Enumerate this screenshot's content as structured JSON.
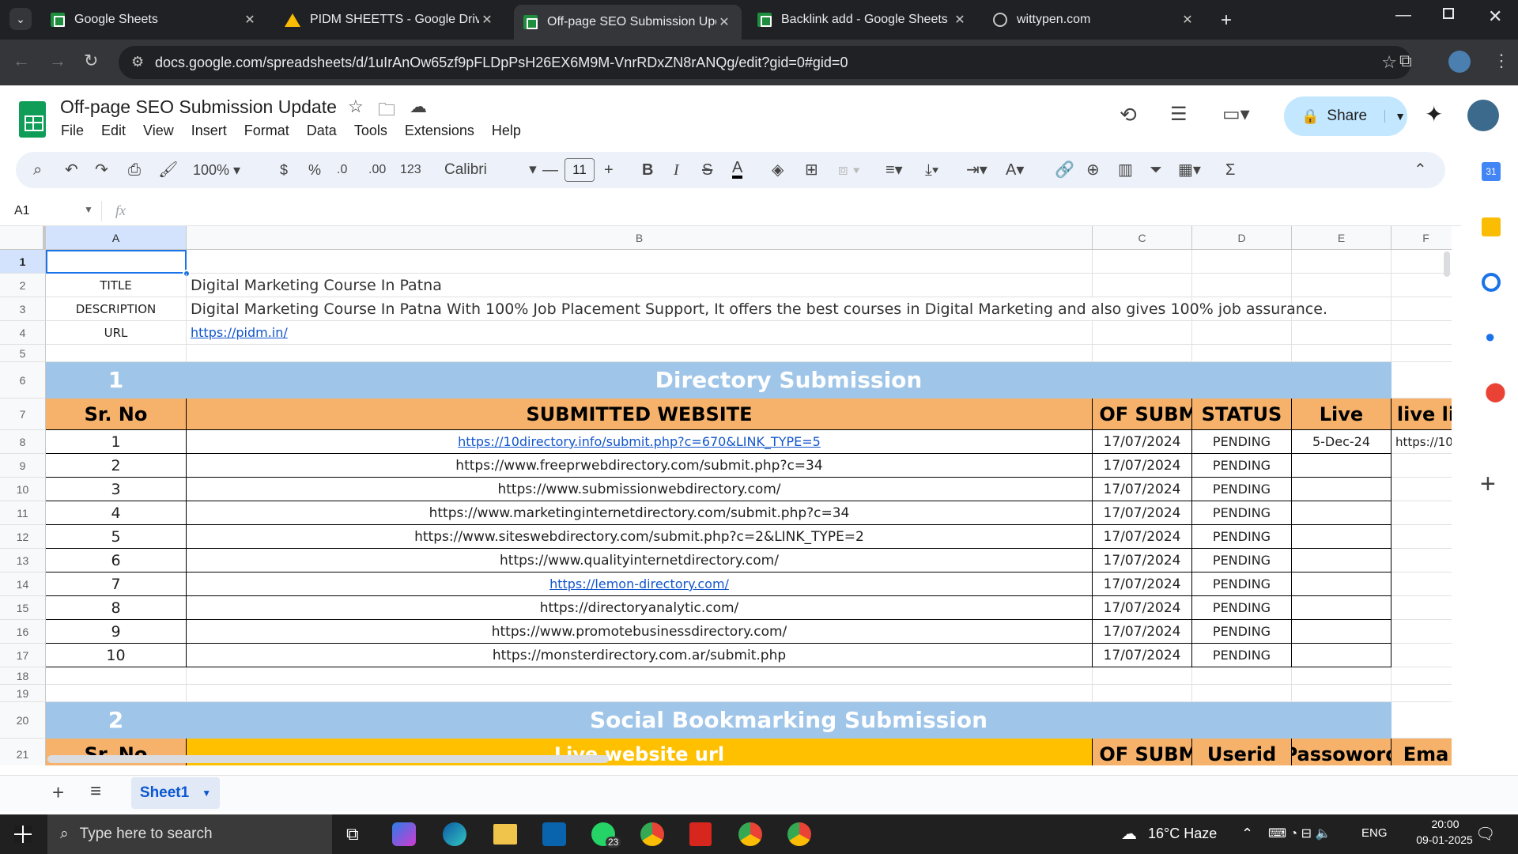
{
  "tabs": [
    {
      "title": "Google Sheets",
      "icon": "sheets"
    },
    {
      "title": "PIDM SHEETTS - Google Drive",
      "icon": "drive"
    },
    {
      "title": "Off-page SEO Submission Upda",
      "icon": "sheets"
    },
    {
      "title": "Backlink add - Google Sheets",
      "icon": "sheets"
    },
    {
      "title": "wittypen.com",
      "icon": "globe"
    }
  ],
  "url": "docs.google.com/spreadsheets/d/1uIrAnOw65zf9pFLDpPsH26EX6M9M-VnrRDxZN8rANQg/edit?gid=0#gid=0",
  "doc_title": "Off-page SEO Submission Update",
  "menus": [
    "File",
    "Edit",
    "View",
    "Insert",
    "Format",
    "Data",
    "Tools",
    "Extensions",
    "Help"
  ],
  "share_label": "Share",
  "toolbar": {
    "zoom": "100%",
    "currency": "$",
    "percent": "%",
    "dec_dec": ".0",
    "inc_dec": ".00",
    "numfmt": "123",
    "font": "Calibri",
    "font_size": "11"
  },
  "cell_ref": "A1",
  "fx": "fx",
  "columns": [
    "A",
    "B",
    "C",
    "D",
    "E",
    "F"
  ],
  "rows": [
    "1",
    "2",
    "3",
    "4",
    "5",
    "6",
    "7",
    "8",
    "9",
    "10",
    "11",
    "12",
    "13",
    "14",
    "15",
    "16",
    "17",
    "18",
    "19",
    "20",
    "21"
  ],
  "meta": {
    "title_label": "TITLE",
    "title": "Digital Marketing Course In Patna",
    "desc_label": "DESCRIPTION",
    "desc": "Digital Marketing Course In Patna With 100% Job Placement Support, It offers the best courses in Digital Marketing and also gives 100% job assurance.",
    "url_label": "URL",
    "url": "https://pidm.in/"
  },
  "section1": {
    "num": "1",
    "title": "Directory Submission",
    "headers": [
      "Sr. No",
      "SUBMITTED WEBSITE",
      "E OF SUBMI",
      "STATUS",
      "Live",
      "live li"
    ],
    "rows": [
      {
        "sr": "1",
        "site": "https://10directory.info/submit.php?c=670&LINK_TYPE=5",
        "date": "17/07/2024",
        "status": "PENDING",
        "live": "5-Dec-24",
        "link": "https://10",
        "is_link": true
      },
      {
        "sr": "2",
        "site": "https://www.freeprwebdirectory.com/submit.php?c=34",
        "date": "17/07/2024",
        "status": "PENDING",
        "live": "",
        "link": "",
        "is_link": false
      },
      {
        "sr": "3",
        "site": "https://www.submissionwebdirectory.com/",
        "date": "17/07/2024",
        "status": "PENDING",
        "live": "",
        "link": "",
        "is_link": false
      },
      {
        "sr": "4",
        "site": "https://www.marketinginternetdirectory.com/submit.php?c=34",
        "date": "17/07/2024",
        "status": "PENDING",
        "live": "",
        "link": "",
        "is_link": false
      },
      {
        "sr": "5",
        "site": "https://www.siteswebdirectory.com/submit.php?c=2&LINK_TYPE=2",
        "date": "17/07/2024",
        "status": "PENDING",
        "live": "",
        "link": "",
        "is_link": false
      },
      {
        "sr": "6",
        "site": "https://www.qualityinternetdirectory.com/",
        "date": "17/07/2024",
        "status": "PENDING",
        "live": "",
        "link": "",
        "is_link": false
      },
      {
        "sr": "7",
        "site": "https://lemon-directory.com/",
        "date": "17/07/2024",
        "status": "PENDING",
        "live": "",
        "link": "",
        "is_link": true
      },
      {
        "sr": "8",
        "site": "https://directoryanalytic.com/",
        "date": "17/07/2024",
        "status": "PENDING",
        "live": "",
        "link": "",
        "is_link": false
      },
      {
        "sr": "9",
        "site": "https://www.promotebusinessdirectory.com/",
        "date": "17/07/2024",
        "status": "PENDING",
        "live": "",
        "link": "",
        "is_link": false
      },
      {
        "sr": "10",
        "site": "https://monsterdirectory.com.ar/submit.php",
        "date": "17/07/2024",
        "status": "PENDING",
        "live": "",
        "link": "",
        "is_link": false
      }
    ]
  },
  "section2": {
    "num": "2",
    "title": "Social Bookmarking Submission",
    "headers": [
      "Sr. No",
      "Live website url",
      "E OF SUBMI",
      "Userid",
      "Passoword",
      "Ema"
    ]
  },
  "sheet_tab": "Sheet1",
  "taskbar": {
    "search": "Type here to search",
    "weather": "16°C  Haze",
    "lang": "ENG",
    "time": "20:00",
    "date": "09-01-2025",
    "whatsapp_badge": "23"
  }
}
